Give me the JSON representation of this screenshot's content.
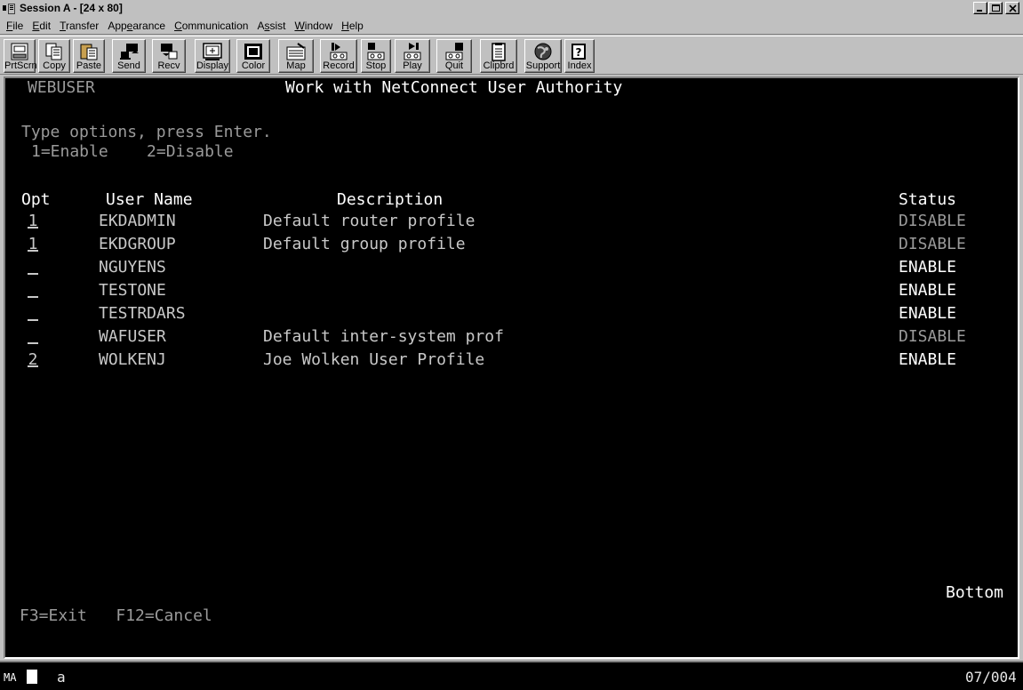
{
  "window": {
    "title": "Session A - [24 x 80]",
    "controls": [
      "minimize",
      "maximize",
      "close"
    ]
  },
  "menu": [
    {
      "label": "File",
      "hotkey": "F"
    },
    {
      "label": "Edit",
      "hotkey": "E"
    },
    {
      "label": "Transfer",
      "hotkey": "T"
    },
    {
      "label": "Appearance",
      "hotkey": "e"
    },
    {
      "label": "Communication",
      "hotkey": "C"
    },
    {
      "label": "Assist",
      "hotkey": "s"
    },
    {
      "label": "Window",
      "hotkey": "W"
    },
    {
      "label": "Help",
      "hotkey": "H"
    }
  ],
  "toolbar": [
    {
      "label": "PrtScrn",
      "icon": "printer-icon"
    },
    {
      "label": "Copy",
      "icon": "copy-icon"
    },
    {
      "label": "Paste",
      "icon": "paste-icon"
    },
    {
      "label": "Send",
      "icon": "send-icon"
    },
    {
      "label": "Recv",
      "icon": "receive-icon"
    },
    {
      "label": "Display",
      "icon": "display-icon"
    },
    {
      "label": "Color",
      "icon": "color-icon"
    },
    {
      "label": "Map",
      "icon": "keyboard-map-icon"
    },
    {
      "label": "Record",
      "icon": "record-icon"
    },
    {
      "label": "Stop",
      "icon": "stop-icon"
    },
    {
      "label": "Play",
      "icon": "play-icon"
    },
    {
      "label": "Quit",
      "icon": "quit-icon"
    },
    {
      "label": "Clipbrd",
      "icon": "clipboard-icon"
    },
    {
      "label": "Support",
      "icon": "support-globe-icon"
    },
    {
      "label": "Index",
      "icon": "help-index-icon"
    }
  ],
  "screen": {
    "system_name": "WEBUSER",
    "title": "Work with NetConnect User Authority",
    "instructions": "Type options, press Enter.",
    "options_legend": "1=Enable    2=Disable",
    "columns": {
      "opt": "Opt",
      "user_name": "User Name",
      "description": "Description",
      "status": "Status"
    },
    "rows": [
      {
        "opt": "1",
        "user": "EKDADMIN",
        "description": "Default router profile",
        "status": "DISABLE"
      },
      {
        "opt": "1",
        "user": "EKDGROUP",
        "description": "Default group profile",
        "status": "DISABLE"
      },
      {
        "opt": "_",
        "user": "NGUYENS",
        "description": "",
        "status": "ENABLE"
      },
      {
        "opt": "_",
        "user": "TESTONE",
        "description": "",
        "status": "ENABLE"
      },
      {
        "opt": "_",
        "user": "TESTRDARS",
        "description": "",
        "status": "ENABLE"
      },
      {
        "opt": "_",
        "user": "WAFUSER",
        "description": "Default inter-system prof",
        "status": "DISABLE"
      },
      {
        "opt": "2",
        "user": "WOLKENJ",
        "description": "Joe Wolken User Profile",
        "status": "ENABLE"
      }
    ],
    "more_indicator": "Bottom",
    "function_keys": "F3=Exit   F12=Cancel"
  },
  "statusbar": {
    "mode": "MA",
    "session_letter": "a",
    "cursor_position": "07/004"
  },
  "colors": {
    "terminal_bg": "#000000",
    "text_bright": "#ffffff",
    "text_dim": "#9a9a9a",
    "chrome": "#c0c0c0"
  }
}
